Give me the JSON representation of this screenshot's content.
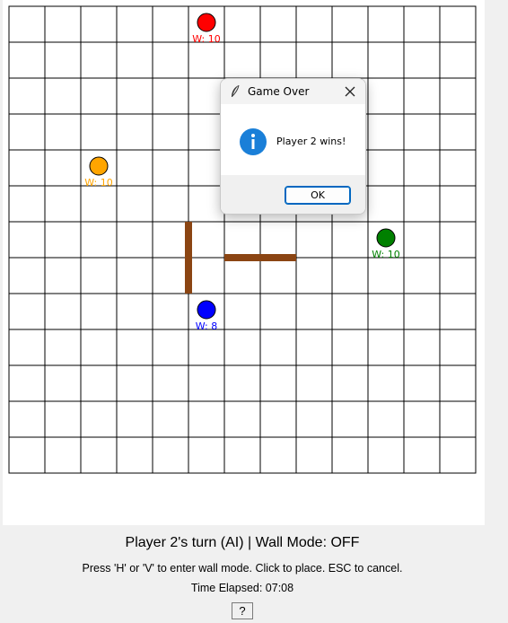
{
  "board": {
    "size": 13,
    "pawns": [
      {
        "name": "player-1-pawn",
        "color": "#ff0000",
        "row": 0,
        "col": 5,
        "label": "W: 10"
      },
      {
        "name": "player-2-pawn",
        "color": "#ffa500",
        "row": 4,
        "col": 2,
        "label": "W: 10"
      },
      {
        "name": "player-3-pawn",
        "color": "#008000",
        "row": 6,
        "col": 10,
        "label": "W: 10"
      },
      {
        "name": "player-4-pawn",
        "color": "#0000ff",
        "row": 8,
        "col": 5,
        "label": "W: 8"
      }
    ],
    "walls": [
      {
        "orientation": "vertical",
        "line": 5,
        "from": 6,
        "to": 8
      },
      {
        "orientation": "horizontal",
        "line": 7,
        "from": 6,
        "to": 8
      }
    ],
    "wall_color": "#8b4513"
  },
  "dialog": {
    "title": "Game Over",
    "message": "Player 2 wins!",
    "ok_label": "OK",
    "icon": "info-icon",
    "accent": "#1a7fd8"
  },
  "status": {
    "turn_text": "Player 2's turn (AI) | Wall Mode: OFF",
    "help_text": "Press 'H' or 'V' to enter wall mode. Click to place. ESC to cancel.",
    "timer_text": "Time Elapsed: 07:08",
    "help_button_label": "?"
  }
}
